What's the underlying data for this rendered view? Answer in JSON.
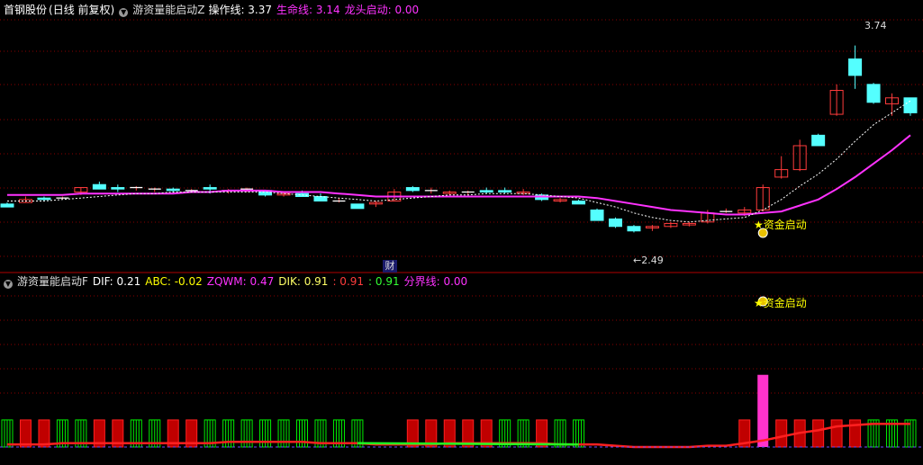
{
  "main_panel": {
    "stock_name": "首钢股份",
    "period": "(日线 前复权)",
    "indicator_name": "游资量能启动Z",
    "op_line_label": "操作线: 3.37",
    "life_line_label": "生命线: 3.14",
    "dragon_label": "龙头启动: 0.00",
    "high_marker": "3.74",
    "low_marker": "2.49",
    "signal_text": "资金启动",
    "cai_badge": "财"
  },
  "sub_panel": {
    "indicator_name": "游资量能启动F",
    "dif_label": "DIF: 0.21",
    "abc_label": "ABC: -0.02",
    "zqwm_label": "ZQWM: 0.47",
    "dik_label": "DIK: 0.91",
    "red_value": ": 0.91",
    "green_value": ": 0.91",
    "boundary_label": "分界线: 0.00",
    "signal_text": "资金启动"
  },
  "colors": {
    "up": "#ff3c3c",
    "down": "#54ffff",
    "life_line": "#ff32ff",
    "op_line": "#ffffff",
    "grid": "#8a0000",
    "bar_red": "#c00000",
    "bar_green": "#00ee00",
    "signal_text": "#ffff00",
    "pink_bar": "#ff33cc"
  },
  "chart_data": [
    {
      "type": "candlestick",
      "title": "游资量能启动Z",
      "series_names": [
        "操作线",
        "生命线"
      ],
      "ylim": [
        2.3,
        3.9
      ],
      "x": [
        1,
        2,
        3,
        4,
        5,
        6,
        7,
        8,
        9,
        10,
        11,
        12,
        13,
        14,
        15,
        16,
        17,
        18,
        19,
        20,
        21,
        22,
        23,
        24,
        25,
        26,
        27,
        28,
        29,
        30,
        31,
        32,
        33,
        34,
        35,
        36,
        37,
        38,
        39,
        40,
        41,
        42,
        43,
        44,
        45,
        46,
        47,
        48,
        49,
        50
      ],
      "candles": [
        [
          2.68,
          2.69,
          2.66,
          2.66
        ],
        [
          2.69,
          2.73,
          2.69,
          2.71
        ],
        [
          2.72,
          2.73,
          2.7,
          2.71
        ],
        [
          2.72,
          2.73,
          2.71,
          2.72
        ],
        [
          2.76,
          2.79,
          2.74,
          2.79
        ],
        [
          2.81,
          2.83,
          2.78,
          2.78
        ],
        [
          2.79,
          2.81,
          2.76,
          2.78
        ],
        [
          2.79,
          2.8,
          2.77,
          2.79
        ],
        [
          2.78,
          2.79,
          2.76,
          2.78
        ],
        [
          2.78,
          2.79,
          2.75,
          2.77
        ],
        [
          2.77,
          2.78,
          2.76,
          2.77
        ],
        [
          2.79,
          2.81,
          2.75,
          2.78
        ],
        [
          2.77,
          2.78,
          2.75,
          2.77
        ],
        [
          2.78,
          2.79,
          2.76,
          2.78
        ],
        [
          2.77,
          2.77,
          2.73,
          2.74
        ],
        [
          2.74,
          2.76,
          2.73,
          2.75
        ],
        [
          2.75,
          2.77,
          2.73,
          2.73
        ],
        [
          2.73,
          2.75,
          2.71,
          2.7
        ],
        [
          2.7,
          2.72,
          2.69,
          2.7
        ],
        [
          2.68,
          2.68,
          2.66,
          2.65
        ],
        [
          2.68,
          2.7,
          2.66,
          2.69
        ],
        [
          2.7,
          2.78,
          2.7,
          2.76
        ],
        [
          2.79,
          2.8,
          2.76,
          2.77
        ],
        [
          2.77,
          2.79,
          2.75,
          2.77
        ],
        [
          2.75,
          2.77,
          2.74,
          2.76
        ],
        [
          2.76,
          2.77,
          2.74,
          2.76
        ],
        [
          2.77,
          2.79,
          2.75,
          2.76
        ],
        [
          2.77,
          2.79,
          2.75,
          2.76
        ],
        [
          2.75,
          2.78,
          2.74,
          2.76
        ],
        [
          2.74,
          2.75,
          2.7,
          2.71
        ],
        [
          2.7,
          2.72,
          2.69,
          2.71
        ],
        [
          2.7,
          2.71,
          2.68,
          2.68
        ],
        [
          2.64,
          2.65,
          2.57,
          2.57
        ],
        [
          2.58,
          2.59,
          2.52,
          2.53
        ],
        [
          2.53,
          2.54,
          2.49,
          2.5
        ],
        [
          2.52,
          2.54,
          2.5,
          2.53
        ],
        [
          2.53,
          2.56,
          2.52,
          2.55
        ],
        [
          2.54,
          2.56,
          2.53,
          2.55
        ],
        [
          2.56,
          2.64,
          2.55,
          2.62
        ],
        [
          2.63,
          2.65,
          2.62,
          2.63
        ],
        [
          2.62,
          2.66,
          2.6,
          2.64
        ],
        [
          2.64,
          2.81,
          2.63,
          2.79
        ],
        [
          2.86,
          3.0,
          2.85,
          2.91
        ],
        [
          2.91,
          3.11,
          2.9,
          3.07
        ],
        [
          3.14,
          3.15,
          3.08,
          3.07
        ],
        [
          3.28,
          3.48,
          3.27,
          3.44
        ],
        [
          3.65,
          3.74,
          3.45,
          3.54
        ],
        [
          3.48,
          3.49,
          3.35,
          3.36
        ],
        [
          3.35,
          3.42,
          3.27,
          3.39
        ],
        [
          3.39,
          3.39,
          3.27,
          3.29
        ]
      ],
      "op_line": [
        2.7,
        2.7,
        2.7,
        2.71,
        2.72,
        2.73,
        2.74,
        2.75,
        2.75,
        2.76,
        2.76,
        2.76,
        2.76,
        2.76,
        2.76,
        2.75,
        2.74,
        2.73,
        2.72,
        2.71,
        2.7,
        2.71,
        2.72,
        2.73,
        2.74,
        2.74,
        2.75,
        2.75,
        2.75,
        2.74,
        2.73,
        2.72,
        2.69,
        2.66,
        2.62,
        2.59,
        2.57,
        2.56,
        2.57,
        2.58,
        2.59,
        2.64,
        2.71,
        2.8,
        2.88,
        2.98,
        3.1,
        3.21,
        3.29,
        3.37
      ],
      "life_line": [
        2.74,
        2.74,
        2.74,
        2.74,
        2.75,
        2.75,
        2.75,
        2.75,
        2.75,
        2.75,
        2.76,
        2.76,
        2.77,
        2.77,
        2.77,
        2.76,
        2.76,
        2.76,
        2.75,
        2.74,
        2.73,
        2.73,
        2.73,
        2.73,
        2.73,
        2.73,
        2.73,
        2.73,
        2.73,
        2.73,
        2.73,
        2.73,
        2.72,
        2.7,
        2.68,
        2.66,
        2.64,
        2.63,
        2.62,
        2.61,
        2.61,
        2.62,
        2.63,
        2.67,
        2.71,
        2.78,
        2.86,
        2.95,
        3.04,
        3.14
      ]
    },
    {
      "type": "bar",
      "title": "游资量能启动F",
      "ylim": [
        0,
        1.2
      ],
      "x": [
        1,
        2,
        3,
        4,
        5,
        6,
        7,
        8,
        9,
        10,
        11,
        12,
        13,
        14,
        15,
        16,
        17,
        18,
        19,
        20,
        21,
        22,
        23,
        24,
        25,
        26,
        27,
        28,
        29,
        30,
        31,
        32,
        33,
        34,
        35,
        36,
        37,
        38,
        39,
        40,
        41,
        42,
        43,
        44,
        45,
        46,
        47,
        48,
        49,
        50
      ],
      "bar_colors": [
        "green",
        "red",
        "red",
        "green",
        "green",
        "red",
        "red",
        "green",
        "green",
        "red",
        "red",
        "green",
        "green",
        "green",
        "green",
        "green",
        "green",
        "green",
        "green",
        "green",
        "none",
        "none",
        "red",
        "red",
        "red",
        "red",
        "red",
        "green",
        "green",
        "red",
        "green",
        "green",
        "none",
        "none",
        "none",
        "none",
        "none",
        "none",
        "none",
        "none",
        "red",
        "pink",
        "red",
        "red",
        "red",
        "red",
        "red",
        "green",
        "green",
        "green"
      ],
      "bar_values": [
        0.21,
        0.21,
        0.21,
        0.21,
        0.21,
        0.21,
        0.21,
        0.21,
        0.21,
        0.21,
        0.21,
        0.21,
        0.21,
        0.21,
        0.21,
        0.21,
        0.21,
        0.21,
        0.21,
        0.21,
        0,
        0,
        0.21,
        0.21,
        0.21,
        0.21,
        0.21,
        0.21,
        0.21,
        0.21,
        0.21,
        0.21,
        0,
        0,
        0,
        0,
        0,
        0,
        0,
        0,
        0.21,
        0.56,
        0.21,
        0.21,
        0.21,
        0.21,
        0.21,
        0.21,
        0.21,
        0.21
      ],
      "dik_line": [
        0.02,
        0.02,
        0.02,
        0.03,
        0.03,
        0.03,
        0.03,
        0.03,
        0.03,
        0.03,
        0.03,
        0.03,
        0.04,
        0.04,
        0.04,
        0.04,
        0.04,
        0.03,
        0.03,
        0.03,
        0.02,
        0.02,
        0.02,
        0.02,
        0.03,
        0.03,
        0.03,
        0.03,
        0.03,
        0.03,
        0.02,
        0.02,
        0.02,
        0.01,
        0.0,
        0.0,
        0.0,
        0.0,
        0.01,
        0.01,
        0.03,
        0.05,
        0.08,
        0.11,
        0.13,
        0.16,
        0.17,
        0.18,
        0.18,
        0.18
      ]
    }
  ]
}
